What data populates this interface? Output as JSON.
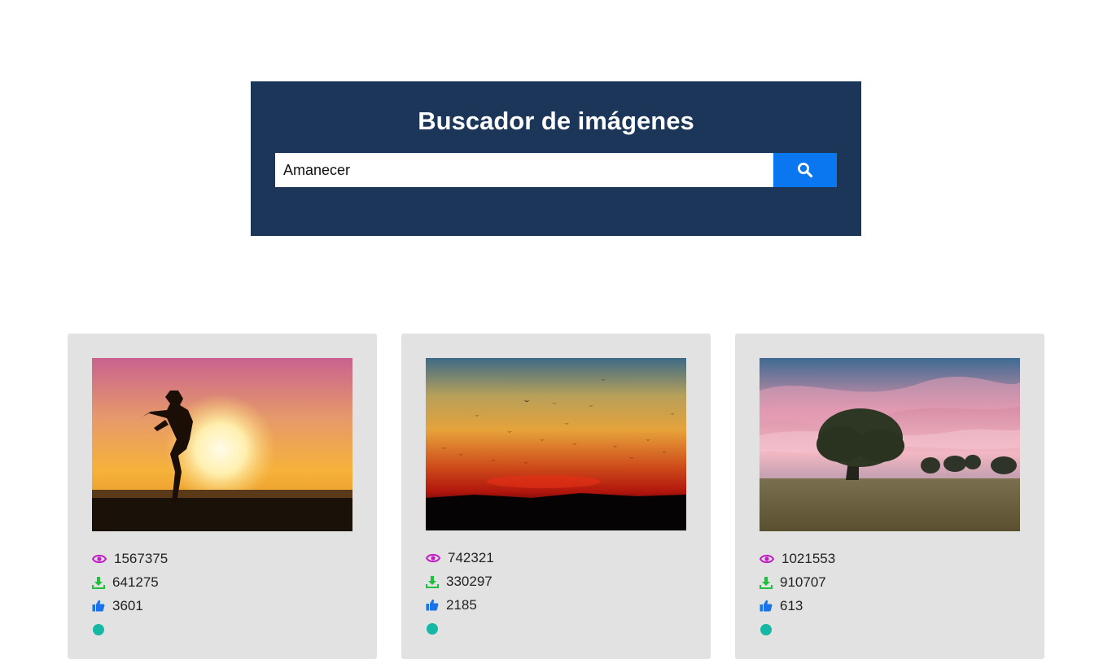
{
  "search": {
    "title": "Buscador de imágenes",
    "query": "Amanecer",
    "button_icon": "search-icon"
  },
  "colors": {
    "panel_bg": "#1b3658",
    "button_bg": "#0a76f0",
    "card_bg": "#e2e2e2",
    "views_icon": "#c01ec4",
    "downloads_icon": "#1fbf3f",
    "likes_icon": "#1a73e8",
    "comments_icon": "#17b7a6"
  },
  "results": [
    {
      "image": "woman-silhouette-sunset-photo",
      "views": "1567375",
      "downloads": "641275",
      "likes": "3601"
    },
    {
      "image": "birds-red-sunset-photo",
      "views": "742321",
      "downloads": "330297",
      "likes": "2185"
    },
    {
      "image": "lone-tree-dawn-photo",
      "views": "1021553",
      "downloads": "910707",
      "likes": "613"
    }
  ]
}
